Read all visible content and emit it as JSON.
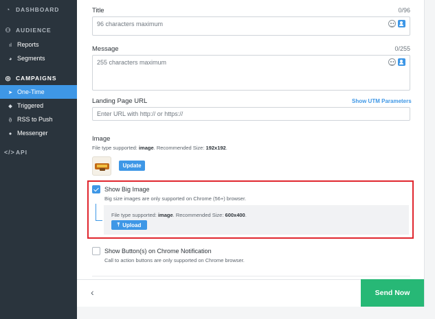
{
  "sidebar": {
    "dashboard": {
      "label": "DASHBOARD",
      "icon": "dashboard-icon"
    },
    "audience": {
      "label": "AUDIENCE",
      "icon": "users-icon",
      "items": [
        {
          "label": "Reports",
          "icon": "bar-chart-icon"
        },
        {
          "label": "Segments",
          "icon": "pie-chart-icon"
        }
      ]
    },
    "campaigns": {
      "label": "CAMPAIGNS",
      "icon": "megaphone-icon",
      "items": [
        {
          "label": "One-Time",
          "icon": "paper-plane-icon",
          "active": true
        },
        {
          "label": "Triggered",
          "icon": "tag-icon"
        },
        {
          "label": "RSS to Push",
          "icon": "rss-icon"
        },
        {
          "label": "Messenger",
          "icon": "chat-bubble-icon"
        }
      ]
    },
    "api": {
      "label": "API",
      "icon": "code-icon"
    }
  },
  "form": {
    "title": {
      "label": "Title",
      "counter": "0/96",
      "placeholder": "96 characters maximum"
    },
    "message": {
      "label": "Message",
      "counter": "0/255",
      "placeholder": "255 characters maximum"
    },
    "landing": {
      "label": "Landing Page URL",
      "link": "Show UTM Parameters",
      "placeholder": "Enter URL with http:// or https://"
    },
    "image": {
      "label": "Image",
      "help_prefix": "File type supported: ",
      "help_type": "image",
      "help_suffix": ". Recommended Size: ",
      "help_size": "192x192",
      "help_end": ".",
      "update_label": "Update"
    },
    "big_image": {
      "checked": true,
      "label": "Show Big Image",
      "note": "Big size images are only supported on Chrome (56+) browser.",
      "help_prefix": "File type supported: ",
      "help_type": "image",
      "help_suffix": ". Recommended Size: ",
      "help_size": "600x400",
      "help_end": ".",
      "upload_label": "Upload"
    },
    "buttons": {
      "checked": false,
      "label": "Show Button(s) on Chrome Notification",
      "note": "Call to action buttons are only supported on Chrome browser."
    }
  },
  "footer": {
    "back": "‹",
    "send_label": "Send Now"
  },
  "colors": {
    "accent": "#3e97e6",
    "sidebar": "#2a343d",
    "send": "#27b876",
    "highlight": "#e0252d"
  }
}
